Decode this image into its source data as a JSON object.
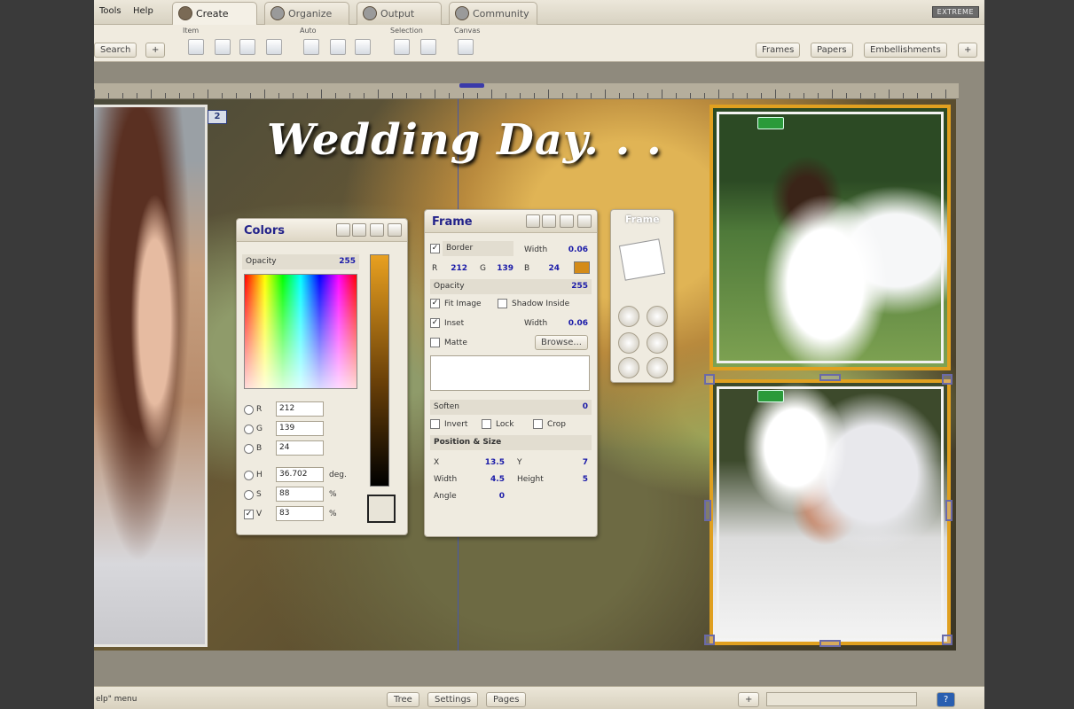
{
  "menu": [
    "Tools",
    "Help"
  ],
  "tabs": [
    {
      "label": "Create",
      "active": true
    },
    {
      "label": "Organize",
      "active": false
    },
    {
      "label": "Output",
      "active": false
    },
    {
      "label": "Community",
      "active": false
    }
  ],
  "edition": "EXTREME",
  "toolbar": {
    "groups": [
      "Item",
      "Auto",
      "Selection",
      "Canvas"
    ],
    "search_label": "Search",
    "plus": "+",
    "right_buttons": [
      "Frames",
      "Papers",
      "Embellishments"
    ]
  },
  "page": {
    "number": "2",
    "title": "Wedding Day. . ."
  },
  "colors_panel": {
    "title": "Colors",
    "opacity_label": "Opacity",
    "opacity_value": "255",
    "fields": [
      {
        "label": "R",
        "value": "212"
      },
      {
        "label": "G",
        "value": "139"
      },
      {
        "label": "B",
        "value": "24"
      },
      {
        "label": "H",
        "value": "36.702",
        "unit": "deg."
      },
      {
        "label": "S",
        "value": "88",
        "unit": "%"
      },
      {
        "label": "V",
        "value": "83",
        "unit": "%"
      }
    ]
  },
  "frame_panel": {
    "title": "Frame",
    "border_label": "Border",
    "width_label": "Width",
    "border_width": "0.06",
    "r_label": "R",
    "r": "212",
    "g_label": "G",
    "g": "139",
    "b_label": "B",
    "b": "24",
    "swatch_color": "#d48b18",
    "opacity_label": "Opacity",
    "opacity": "255",
    "fit_image": "Fit Image",
    "shadow_inside": "Shadow Inside",
    "inset_label": "Inset",
    "inset_width": "0.06",
    "matte_label": "Matte",
    "browse_label": "Browse...",
    "soften_label": "Soften",
    "soften": "0",
    "invert_label": "Invert",
    "lock_label": "Lock",
    "crop_label": "Crop",
    "pos_header": "Position & Size",
    "x_label": "X",
    "x": "13.5",
    "y_label": "Y",
    "y": "7",
    "w_label": "Width",
    "w": "4.5",
    "h_label": "Height",
    "h": "5",
    "angle_label": "Angle",
    "angle": "0"
  },
  "tool_panel": {
    "title": "Frame"
  },
  "status": {
    "left_text": "elp\" menu",
    "buttons": [
      "Tree",
      "Settings",
      "Pages"
    ],
    "help": "?"
  },
  "colors": {
    "accent": "#e0a020",
    "title_blue": "#23238a"
  }
}
